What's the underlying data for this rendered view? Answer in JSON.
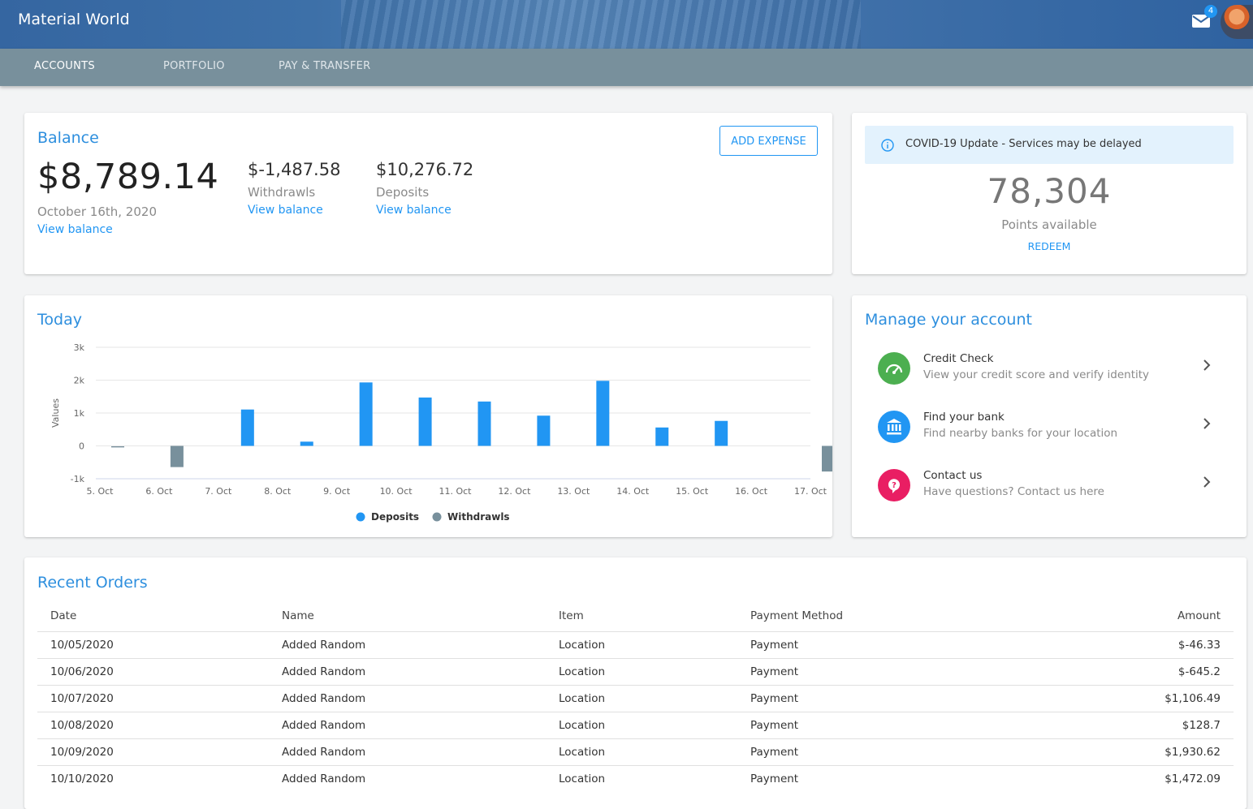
{
  "app": {
    "title": "Material World",
    "mail_count": "4"
  },
  "tabs": [
    {
      "label": "ACCOUNTS",
      "active": true
    },
    {
      "label": "PORTFOLIO",
      "active": false
    },
    {
      "label": "PAY & TRANSFER",
      "active": false
    }
  ],
  "balance": {
    "title": "Balance",
    "amount": "$8,789.14",
    "date": "October 16th, 2020",
    "view_link": "View balance",
    "withdrawals_amount": "$-1,487.58",
    "withdrawals_label": "Withdrawls",
    "withdrawals_link": "View balance",
    "deposits_amount": "$10,276.72",
    "deposits_label": "Deposits",
    "deposits_link": "View balance",
    "add_expense_label": "ADD EXPENSE"
  },
  "points": {
    "alert": "COVID-19 Update - Services may be delayed",
    "value": "78,304",
    "label": "Points available",
    "redeem_label": "REDEEM"
  },
  "today": {
    "title": "Today"
  },
  "manage": {
    "title": "Manage your account",
    "items": [
      {
        "title": "Credit Check",
        "subtitle": "View your credit score and verify identity",
        "icon": "speedometer-icon",
        "color": "#4caf50"
      },
      {
        "title": "Find your bank",
        "subtitle": "Find nearby banks for your location",
        "icon": "bank-icon",
        "color": "#2196f3"
      },
      {
        "title": "Contact us",
        "subtitle": "Have questions? Contact us here",
        "icon": "help-icon",
        "color": "#e91e63"
      }
    ]
  },
  "orders": {
    "title": "Recent Orders",
    "columns": [
      "Date",
      "Name",
      "Item",
      "Payment Method",
      "Amount"
    ],
    "rows": [
      [
        "10/05/2020",
        "Added Random",
        "Location",
        "Payment",
        "$-46.33"
      ],
      [
        "10/06/2020",
        "Added Random",
        "Location",
        "Payment",
        "$-645.2"
      ],
      [
        "10/07/2020",
        "Added Random",
        "Location",
        "Payment",
        "$1,106.49"
      ],
      [
        "10/08/2020",
        "Added Random",
        "Location",
        "Payment",
        "$128.7"
      ],
      [
        "10/09/2020",
        "Added Random",
        "Location",
        "Payment",
        "$1,930.62"
      ],
      [
        "10/10/2020",
        "Added Random",
        "Location",
        "Payment",
        "$1,472.09"
      ]
    ]
  },
  "chart_data": {
    "type": "bar",
    "categories": [
      "5. Oct",
      "6. Oct",
      "7. Oct",
      "8. Oct",
      "9. Oct",
      "10. Oct",
      "11. Oct",
      "12. Oct",
      "13. Oct",
      "14. Oct",
      "15. Oct",
      "16. Oct",
      "17. Oct"
    ],
    "series": [
      {
        "name": "Deposits",
        "color": "#2196f3",
        "values": [
          0,
          0,
          1106.49,
          128.7,
          1930.62,
          1472.09,
          1350,
          920,
          1980,
          560,
          760,
          0,
          0
        ]
      },
      {
        "name": "Withdrawls",
        "color": "#78909c",
        "values": [
          -46.33,
          -645.2,
          0,
          0,
          0,
          0,
          0,
          0,
          0,
          0,
          0,
          0,
          -780
        ]
      }
    ],
    "ylabel": "Values",
    "yticks": [
      "3k",
      "2k",
      "1k",
      "0",
      "-1k"
    ],
    "ylim": [
      -1000,
      3000
    ],
    "grid": true,
    "legend_position": "bottom-center"
  },
  "colors": {
    "accent": "#2196f3",
    "tabbar": "#78909c",
    "appbar": "#3566a1"
  }
}
